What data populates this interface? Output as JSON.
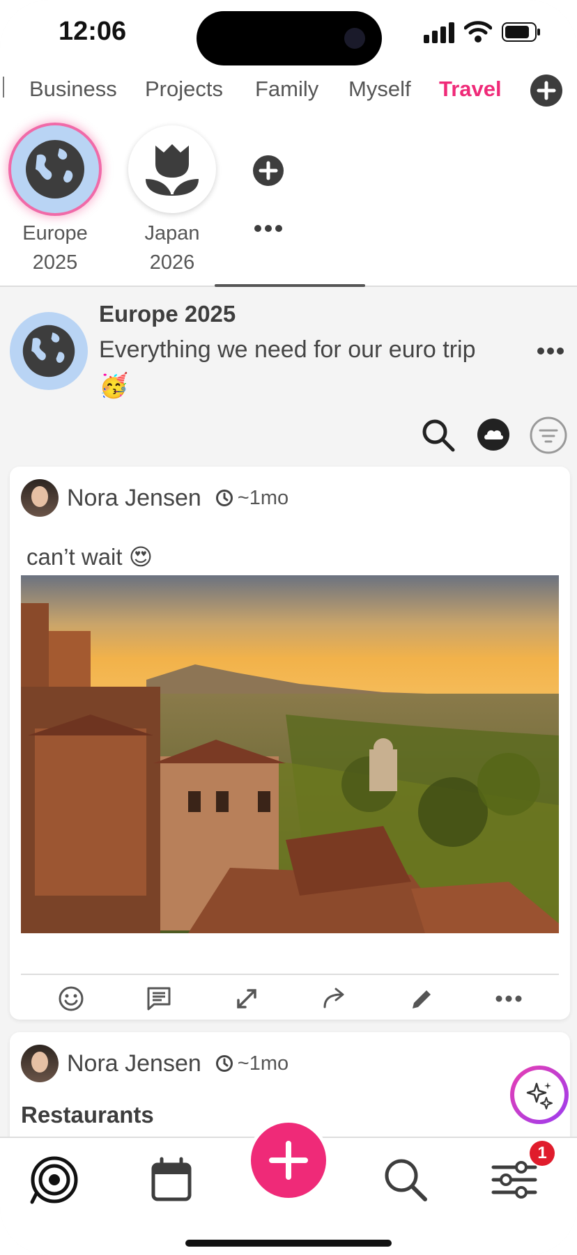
{
  "status": {
    "time": "12:06"
  },
  "categories": {
    "items": [
      "Business",
      "Projects",
      "Family",
      "Myself",
      "Travel"
    ],
    "active": "Travel"
  },
  "stories": [
    {
      "label_line1": "Europe",
      "label_line2": "2025",
      "icon": "globe-icon"
    },
    {
      "label_line1": "Japan",
      "label_line2": "2026",
      "icon": "tulip-icon"
    }
  ],
  "group": {
    "title": "Europe 2025",
    "description": "Everything we need for our euro trip 🥳"
  },
  "posts": [
    {
      "author": "Nora Jensen",
      "ago": "~1mo",
      "text": "can’t wait 😍"
    },
    {
      "author": "Nora Jensen",
      "ago": "~1mo",
      "heading": "Restaurants"
    }
  ],
  "nav": {
    "badge_count": "1"
  },
  "colors": {
    "accent": "#ef2a78",
    "story_bg": "#b9d4f4",
    "dark_icon": "#3d3d3d"
  }
}
